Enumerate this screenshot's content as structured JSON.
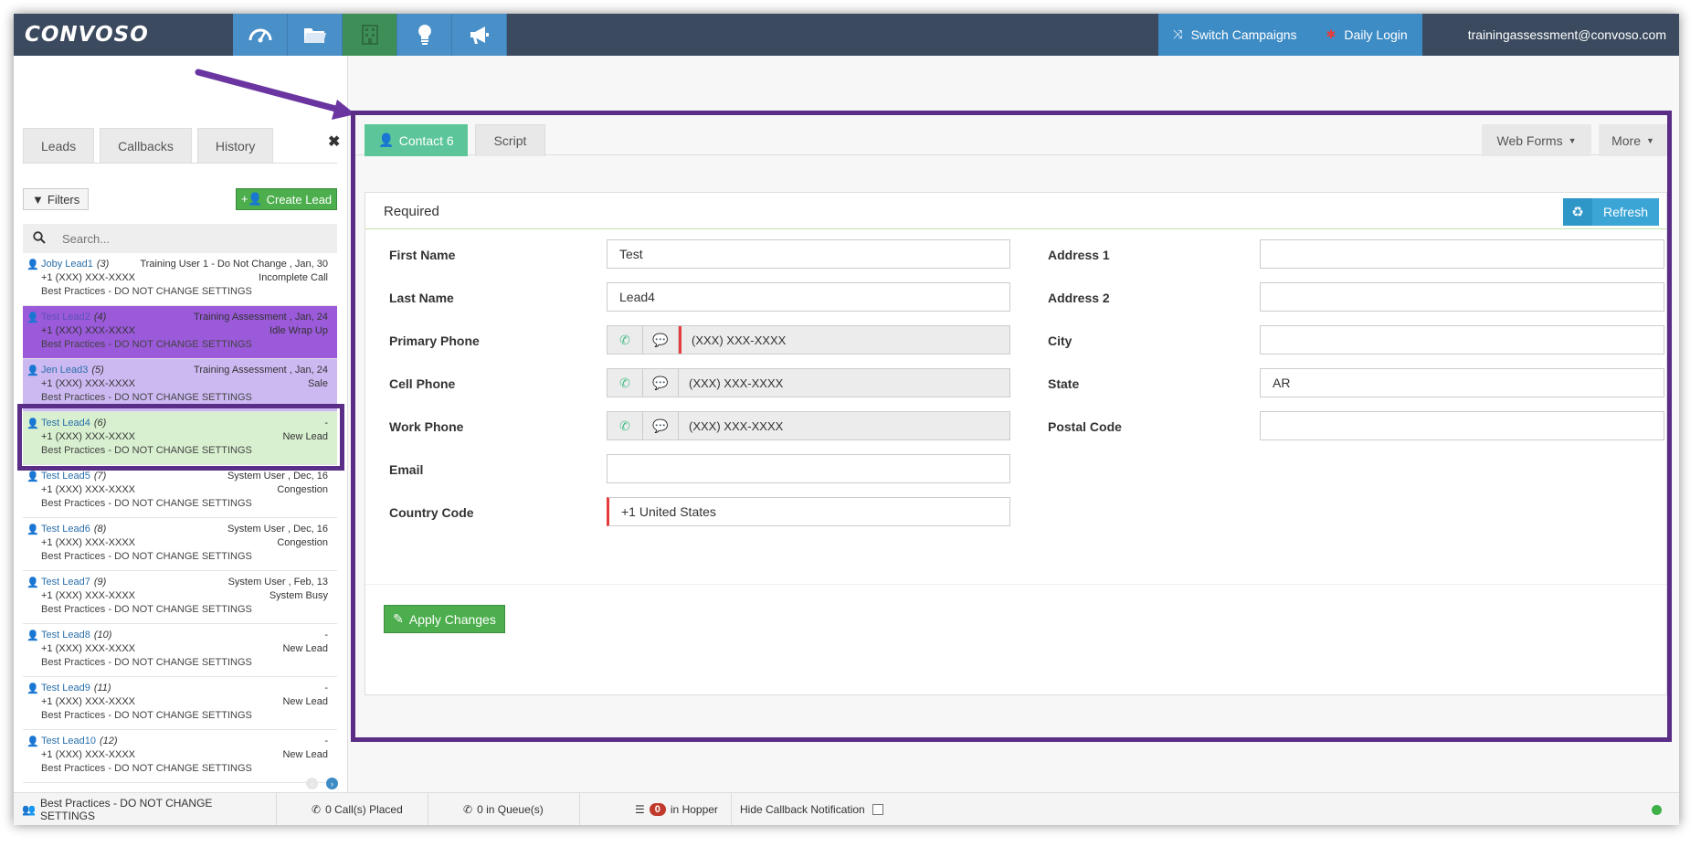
{
  "app": {
    "logo": "CONVOSO",
    "user_email": "trainingassessment@convoso.com",
    "switch_campaigns": "Switch Campaigns",
    "daily_login": "Daily Login",
    "nav_icons": [
      "dashboard-icon",
      "folder-icon",
      "building-icon",
      "lightbulb-icon",
      "megaphone-icon"
    ]
  },
  "left": {
    "tabs": [
      "Leads",
      "Callbacks",
      "History"
    ],
    "filters": "Filters",
    "create_lead": "Create Lead",
    "search_placeholder": "Search...",
    "leads": [
      {
        "name": "Joby Lead1",
        "num": "(3)",
        "agent": "Training User 1 - Do Not Change , Jan, 30",
        "phone": "+1 (XXX) XXX-XXXX",
        "status": "Incomplete Call",
        "campaign": "Best Practices - DO NOT CHANGE SETTINGS",
        "style": ""
      },
      {
        "name": "Test Lead2",
        "num": "(4)",
        "agent": "Training Assessment , Jan, 24",
        "phone": "+1 (XXX) XXX-XXXX",
        "status": "Idle Wrap Up",
        "campaign": "Best Practices - DO NOT CHANGE SETTINGS",
        "style": "purple"
      },
      {
        "name": "Jen Lead3",
        "num": "(5)",
        "agent": "Training Assessment , Jan, 24",
        "phone": "+1 (XXX) XXX-XXXX",
        "status": "Sale",
        "campaign": "Best Practices - DO NOT CHANGE SETTINGS",
        "style": "lavender"
      },
      {
        "name": "Test Lead4",
        "num": "(6)",
        "agent": "-",
        "phone": "+1 (XXX) XXX-XXXX",
        "status": "New Lead",
        "campaign": "Best Practices - DO NOT CHANGE SETTINGS",
        "style": "green"
      },
      {
        "name": "Test Lead5",
        "num": "(7)",
        "agent": "System User , Dec, 16",
        "phone": "+1 (XXX) XXX-XXXX",
        "status": "Congestion",
        "campaign": "Best Practices - DO NOT CHANGE SETTINGS",
        "style": ""
      },
      {
        "name": "Test Lead6",
        "num": "(8)",
        "agent": "System User , Dec, 16",
        "phone": "+1 (XXX) XXX-XXXX",
        "status": "Congestion",
        "campaign": "Best Practices - DO NOT CHANGE SETTINGS",
        "style": ""
      },
      {
        "name": "Test Lead7",
        "num": "(9)",
        "agent": "System User , Feb, 13",
        "phone": "+1 (XXX) XXX-XXXX",
        "status": "System Busy",
        "campaign": "Best Practices - DO NOT CHANGE SETTINGS",
        "style": ""
      },
      {
        "name": "Test Lead8",
        "num": "(10)",
        "agent": "-",
        "phone": "+1 (XXX) XXX-XXXX",
        "status": "New Lead",
        "campaign": "Best Practices - DO NOT CHANGE SETTINGS",
        "style": ""
      },
      {
        "name": "Test Lead9",
        "num": "(11)",
        "agent": "-",
        "phone": "+1 (XXX) XXX-XXXX",
        "status": "New Lead",
        "campaign": "Best Practices - DO NOT CHANGE SETTINGS",
        "style": ""
      },
      {
        "name": "Test Lead10",
        "num": "(12)",
        "agent": "-",
        "phone": "+1 (XXX) XXX-XXXX",
        "status": "New Lead",
        "campaign": "Best Practices - DO NOT CHANGE SETTINGS",
        "style": ""
      }
    ]
  },
  "main": {
    "tab_contact": "Contact 6",
    "tab_script": "Script",
    "web_forms": "Web Forms",
    "more": "More",
    "section_title": "Required",
    "refresh": "Refresh",
    "apply": "Apply Changes",
    "fields": {
      "first_name": {
        "label": "First Name",
        "value": "Test"
      },
      "last_name": {
        "label": "Last Name",
        "value": "Lead4"
      },
      "primary_phone": {
        "label": "Primary Phone",
        "value": "(XXX) XXX-XXXX"
      },
      "cell_phone": {
        "label": "Cell Phone",
        "value": "(XXX) XXX-XXXX"
      },
      "work_phone": {
        "label": "Work Phone",
        "value": "(XXX) XXX-XXXX"
      },
      "email": {
        "label": "Email",
        "value": ""
      },
      "country_code": {
        "label": "Country Code",
        "value": "+1 United States"
      },
      "address1": {
        "label": "Address 1",
        "value": ""
      },
      "address2": {
        "label": "Address 2",
        "value": ""
      },
      "city": {
        "label": "City",
        "value": ""
      },
      "state": {
        "label": "State",
        "value": "AR"
      },
      "postal_code": {
        "label": "Postal Code",
        "value": ""
      }
    }
  },
  "statusbar": {
    "campaign": "Best Practices - DO NOT CHANGE SETTINGS",
    "calls_placed": "0 Call(s) Placed",
    "in_queue": "0 in Queue(s)",
    "hopper_count": "0",
    "hopper_label": "in Hopper",
    "hide_callback": "Hide Callback Notification"
  },
  "colors": {
    "topbar": "#3b4a5e",
    "accent_blue": "#3e8cc6",
    "contact_tab": "#5cc69a",
    "annotation_purple": "#5a2d86",
    "lead_purple": "#9a5ad9",
    "lead_lavender": "#cdb9f2",
    "lead_green": "#d8f0d0"
  }
}
